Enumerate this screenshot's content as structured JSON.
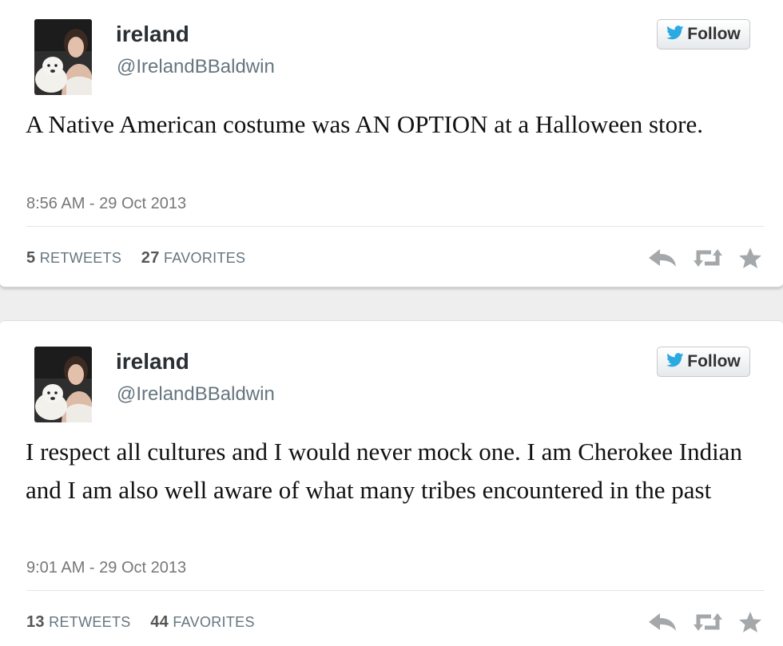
{
  "colors": {
    "twitter_blue": "#2ba9e1",
    "action_icon_gray": "#a5a8ab",
    "handle_gray": "#66757f"
  },
  "tweets": [
    {
      "display_name": "ireland",
      "handle": "@IrelandBBaldwin",
      "follow_label": "Follow",
      "text": "A Native American costume was AN OPTION at a Halloween store.",
      "timestamp": "8:56 AM - 29 Oct 2013",
      "retweets": "5",
      "retweets_label": "RETWEETS",
      "favorites": "27",
      "favorites_label": "FAVORITES",
      "icons": [
        "twitter-bird-icon",
        "reply-icon",
        "retweet-icon",
        "favorite-star-icon"
      ]
    },
    {
      "display_name": "ireland",
      "handle": "@IrelandBBaldwin",
      "follow_label": "Follow",
      "text": "I respect all cultures and I would never mock one. I am Cherokee Indian and I am also well aware of what many tribes encountered in the past",
      "timestamp": "9:01 AM - 29 Oct 2013",
      "retweets": "13",
      "retweets_label": "RETWEETS",
      "favorites": "44",
      "favorites_label": "FAVORITES",
      "icons": [
        "twitter-bird-icon",
        "reply-icon",
        "retweet-icon",
        "favorite-star-icon"
      ]
    }
  ]
}
